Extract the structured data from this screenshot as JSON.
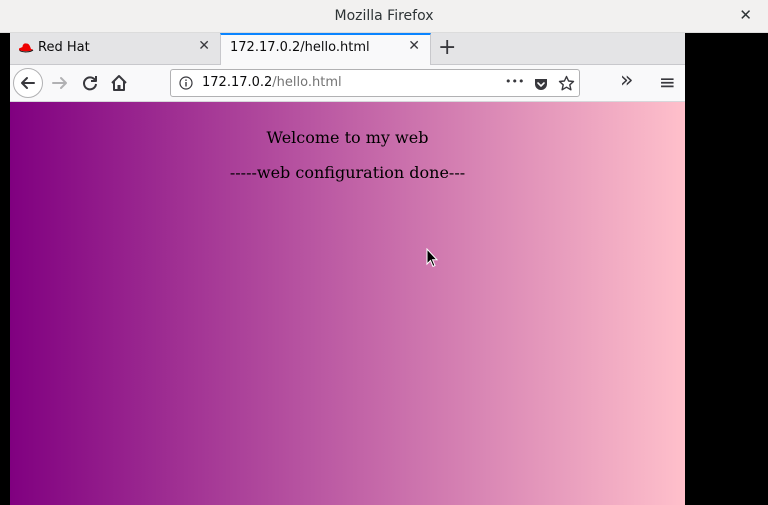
{
  "window": {
    "title": "Mozilla Firefox",
    "close_glyph": "✕"
  },
  "tabs": [
    {
      "label": "Red Hat",
      "close_glyph": "✕",
      "active": false
    },
    {
      "label": "172.17.0.2/hello.html",
      "close_glyph": "✕",
      "active": true
    }
  ],
  "toolbar": {
    "new_tab_glyph": "+",
    "more_glyph": "•••",
    "overflow_glyph": "»",
    "menu_glyph": "≡"
  },
  "url": {
    "host": "172.17.0.2",
    "path": "/hello.html"
  },
  "page": {
    "welcome": "Welcome to my web",
    "done": "-----web configuration done---",
    "gradient_start": "#800080",
    "gradient_end": "#ffc0cb"
  },
  "colors": {
    "accent": "#0a84ff"
  }
}
